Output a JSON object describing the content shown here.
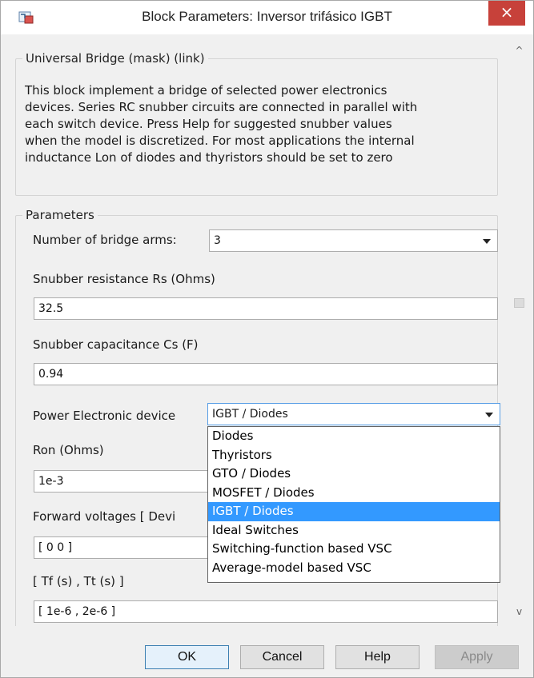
{
  "window": {
    "title": "Block Parameters: Inversor trifásico IGBT",
    "close_glyph": "×",
    "accent_close": "#c7413a",
    "icon": "simulink-block-icon"
  },
  "mask": {
    "group_title": "Universal Bridge (mask) (link)",
    "description_lines": [
      "This block implement a bridge of selected power electronics",
      "devices.  Series RC snubber circuits are connected in parallel with",
      "each switch device.  Press Help for suggested snubber values",
      "when the model is discretized. For most applications the internal",
      "inductance Lon of diodes and thyristors should be set to zero"
    ]
  },
  "params": {
    "group_title": "Parameters",
    "bridge_arms_label": "Number of bridge arms:",
    "bridge_arms_value": "3",
    "rs_label": "Snubber resistance Rs (Ohms)",
    "rs_value": "32.5",
    "cs_label": "Snubber capacitance Cs (F)",
    "cs_value": "0.94",
    "device_label": "Power Electronic device",
    "device_value": "IGBT / Diodes",
    "ron_label": "Ron (Ohms)",
    "ron_value": "1e-3",
    "fwd_label": "Forward voltages  [ Devi",
    "fwd_value": "[  0  0  ]",
    "tf_label": "[  Tf (s) , Tt (s)  ]",
    "tf_value": "[ 1e-6 , 2e-6 ]"
  },
  "device_options": [
    "Diodes",
    "Thyristors",
    "GTO / Diodes",
    "MOSFET / Diodes",
    "IGBT / Diodes",
    "Ideal Switches",
    "Switching-function based VSC",
    "Average-model based VSC"
  ],
  "selected_option_index": 4,
  "buttons": {
    "ok": "OK",
    "cancel": "Cancel",
    "help": "Help",
    "apply": "Apply"
  },
  "scroll": {
    "up": "^",
    "down": "v"
  },
  "colors": {
    "highlight": "#3399ff",
    "focus_border": "#569de5"
  }
}
